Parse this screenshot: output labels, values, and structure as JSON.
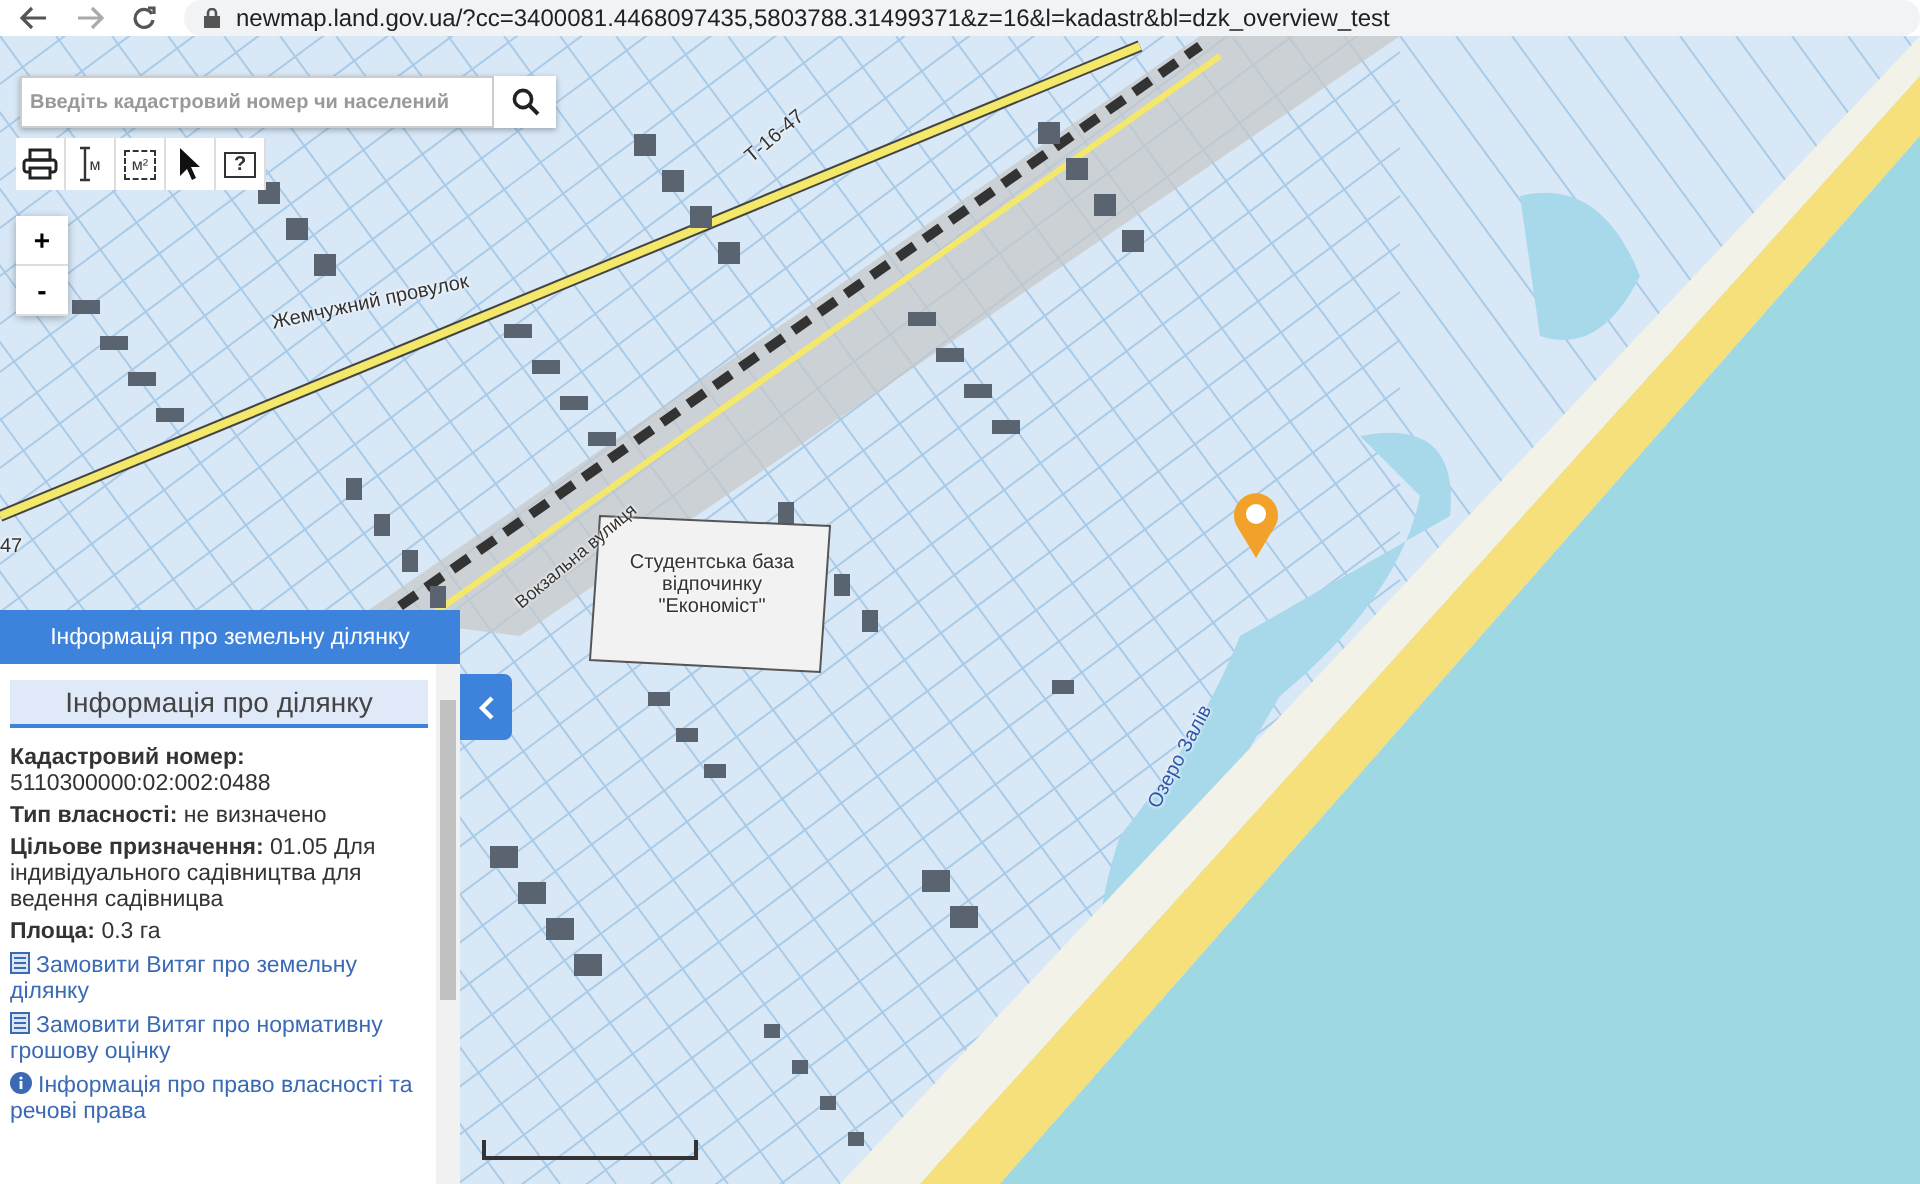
{
  "browser": {
    "url": "newmap.land.gov.ua/?cc=3400081.4468097435,5803788.31499371&z=16&l=kadastr&bl=dzk_overview_test"
  },
  "search": {
    "placeholder": "Введіть кадастровий номер чи населений"
  },
  "tools": [
    {
      "kind": "print"
    },
    {
      "kind": "length",
      "label": "м"
    },
    {
      "kind": "area",
      "label": "м²"
    },
    {
      "kind": "pointer"
    },
    {
      "kind": "help",
      "label": "?"
    }
  ],
  "zoom": [
    "+",
    "-"
  ],
  "map_labels": [
    {
      "text": "Т-16-47"
    },
    {
      "text": "Жемчужний провулок"
    },
    {
      "text": "Вокзальна вулиця"
    },
    {
      "text": "Студентська база відпочинку \"Економіст\""
    },
    {
      "text": "Озеро Залів"
    },
    {
      "text": "47"
    }
  ],
  "panel": {
    "title": "Інформація про земельну ділянку",
    "section": "Інформація про ділянку",
    "fields": [
      {
        "label": "Кадастровий номер:",
        "value": "5110300000:02:002:0488"
      },
      {
        "label": "Тип власності:",
        "value": "не визначено"
      },
      {
        "label": "Цільове призначення:",
        "value": "01.05 Для індивідуального садівництва для ведення садівницва"
      },
      {
        "label": "Площа:",
        "value": "0.3 га"
      }
    ],
    "links": [
      {
        "kind": "document",
        "text": "Замовити Витяг про земельну ділянку"
      },
      {
        "kind": "document",
        "text": "Замовити Витяг про нормативну грошову оцінку"
      },
      {
        "kind": "info",
        "text": "Інформація про право власності та речові права"
      }
    ]
  }
}
